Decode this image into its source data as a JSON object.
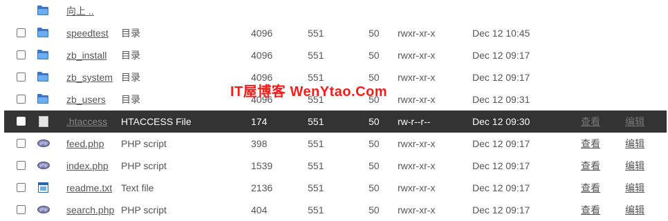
{
  "parent": {
    "label": "向上 .."
  },
  "watermark": "IT屋博客 WenYtao.Com",
  "files": [
    {
      "name": "speedtest",
      "type": "目录",
      "size": "4096",
      "owner": "551",
      "group": "50",
      "perm": "rwxr-xr-x",
      "date": "Dec 12 10:45",
      "icon": "folder-icon",
      "view": "",
      "edit": ""
    },
    {
      "name": "zb_install",
      "type": "目录",
      "size": "4096",
      "owner": "551",
      "group": "50",
      "perm": "rwxr-xr-x",
      "date": "Dec 12 09:17",
      "icon": "folder-icon",
      "view": "",
      "edit": ""
    },
    {
      "name": "zb_system",
      "type": "目录",
      "size": "4096",
      "owner": "551",
      "group": "50",
      "perm": "rwxr-xr-x",
      "date": "Dec 12 09:17",
      "icon": "folder-icon",
      "view": "",
      "edit": ""
    },
    {
      "name": "zb_users",
      "type": "目录",
      "size": "4096",
      "owner": "551",
      "group": "50",
      "perm": "rwxr-xr-x",
      "date": "Dec 12 09:31",
      "icon": "folder-icon",
      "view": "",
      "edit": ""
    },
    {
      "name": ".htaccess",
      "type": "HTACCESS File",
      "size": "174",
      "owner": "551",
      "group": "50",
      "perm": "rw-r--r--",
      "date": "Dec 12 09:30",
      "icon": "blank-file-icon",
      "view": "查看",
      "edit": "编辑"
    },
    {
      "name": "feed.php",
      "type": "PHP script",
      "size": "398",
      "owner": "551",
      "group": "50",
      "perm": "rwxr-xr-x",
      "date": "Dec 12 09:17",
      "icon": "php-icon",
      "view": "查看",
      "edit": "编辑"
    },
    {
      "name": "index.php",
      "type": "PHP script",
      "size": "1539",
      "owner": "551",
      "group": "50",
      "perm": "rwxr-xr-x",
      "date": "Dec 12 09:17",
      "icon": "php-icon",
      "view": "查看",
      "edit": "编辑"
    },
    {
      "name": "readme.txt",
      "type": "Text file",
      "size": "2136",
      "owner": "551",
      "group": "50",
      "perm": "rwxr-xr-x",
      "date": "Dec 12 09:17",
      "icon": "text-file-icon",
      "view": "查看",
      "edit": "编辑"
    },
    {
      "name": "search.php",
      "type": "PHP script",
      "size": "404",
      "owner": "551",
      "group": "50",
      "perm": "rwxr-xr-x",
      "date": "Dec 12 09:17",
      "icon": "php-icon",
      "view": "查看",
      "edit": "编辑"
    }
  ],
  "highlight_row_color": "#333333",
  "watermark_color": "#ff1a1a"
}
